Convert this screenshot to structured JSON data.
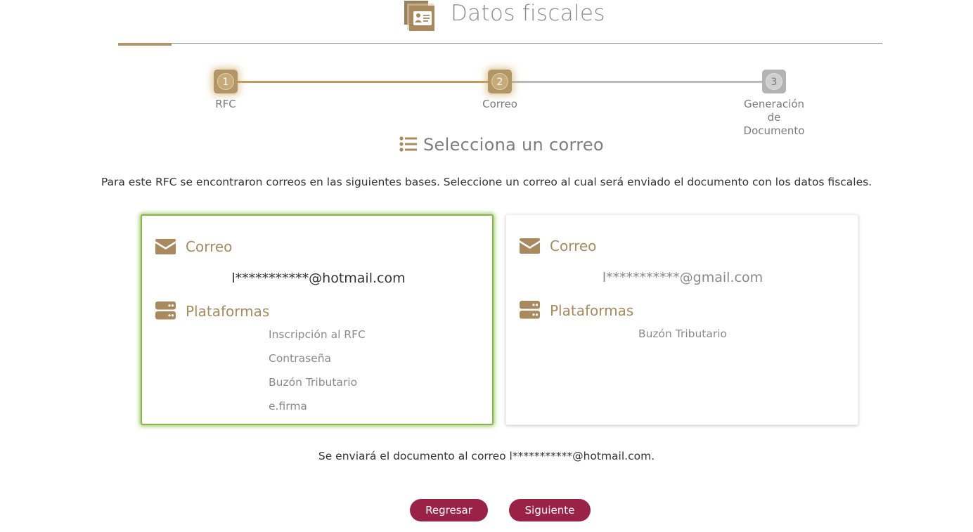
{
  "header": {
    "title": "Datos fiscales",
    "icon": "id-card-icon"
  },
  "stepper": {
    "steps": [
      {
        "number": "1",
        "label": "RFC"
      },
      {
        "number": "2",
        "label": "Correo"
      },
      {
        "number": "3",
        "label_lines": [
          "Generación",
          "de",
          "Documento"
        ]
      }
    ],
    "current_step": 2
  },
  "section": {
    "title": "Selecciona un correo",
    "icon": "list-icon"
  },
  "intro_text": "Para este RFC se encontraron correos en las siguientes bases. Seleccione un correo al cual será enviado el documento con los datos fiscales.",
  "cards": [
    {
      "selected": true,
      "email_heading": "Correo",
      "email": "l***********@hotmail.com",
      "platforms_heading": "Plataformas",
      "platforms": [
        "Inscripción al RFC",
        "Contraseña",
        "Buzón Tributario",
        "e.firma"
      ]
    },
    {
      "selected": false,
      "email_heading": "Correo",
      "email": "l***********@gmail.com",
      "platforms_heading": "Plataformas",
      "platforms": [
        "Buzón Tributario"
      ]
    }
  ],
  "summary_text": "Se enviará el documento al correo l***********@hotmail.com.",
  "buttons": {
    "back": "Regresar",
    "next": "Siguiente"
  },
  "colors": {
    "accent_gold": "#b39666",
    "button_maroon": "#9b2247",
    "selected_green": "#86b845",
    "step_inactive": "#b3b3b3"
  }
}
